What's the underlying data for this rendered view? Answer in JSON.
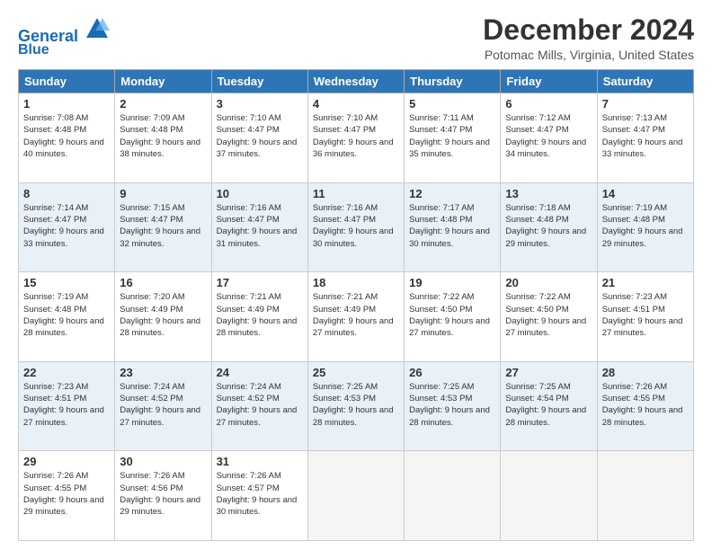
{
  "header": {
    "logo_line1": "General",
    "logo_line2": "Blue",
    "month_title": "December 2024",
    "location": "Potomac Mills, Virginia, United States"
  },
  "days_of_week": [
    "Sunday",
    "Monday",
    "Tuesday",
    "Wednesday",
    "Thursday",
    "Friday",
    "Saturday"
  ],
  "weeks": [
    [
      {
        "day": "1",
        "sunrise": "7:08 AM",
        "sunset": "4:48 PM",
        "daylight": "9 hours and 40 minutes."
      },
      {
        "day": "2",
        "sunrise": "7:09 AM",
        "sunset": "4:48 PM",
        "daylight": "9 hours and 38 minutes."
      },
      {
        "day": "3",
        "sunrise": "7:10 AM",
        "sunset": "4:47 PM",
        "daylight": "9 hours and 37 minutes."
      },
      {
        "day": "4",
        "sunrise": "7:10 AM",
        "sunset": "4:47 PM",
        "daylight": "9 hours and 36 minutes."
      },
      {
        "day": "5",
        "sunrise": "7:11 AM",
        "sunset": "4:47 PM",
        "daylight": "9 hours and 35 minutes."
      },
      {
        "day": "6",
        "sunrise": "7:12 AM",
        "sunset": "4:47 PM",
        "daylight": "9 hours and 34 minutes."
      },
      {
        "day": "7",
        "sunrise": "7:13 AM",
        "sunset": "4:47 PM",
        "daylight": "9 hours and 33 minutes."
      }
    ],
    [
      {
        "day": "8",
        "sunrise": "7:14 AM",
        "sunset": "4:47 PM",
        "daylight": "9 hours and 33 minutes."
      },
      {
        "day": "9",
        "sunrise": "7:15 AM",
        "sunset": "4:47 PM",
        "daylight": "9 hours and 32 minutes."
      },
      {
        "day": "10",
        "sunrise": "7:16 AM",
        "sunset": "4:47 PM",
        "daylight": "9 hours and 31 minutes."
      },
      {
        "day": "11",
        "sunrise": "7:16 AM",
        "sunset": "4:47 PM",
        "daylight": "9 hours and 30 minutes."
      },
      {
        "day": "12",
        "sunrise": "7:17 AM",
        "sunset": "4:48 PM",
        "daylight": "9 hours and 30 minutes."
      },
      {
        "day": "13",
        "sunrise": "7:18 AM",
        "sunset": "4:48 PM",
        "daylight": "9 hours and 29 minutes."
      },
      {
        "day": "14",
        "sunrise": "7:19 AM",
        "sunset": "4:48 PM",
        "daylight": "9 hours and 29 minutes."
      }
    ],
    [
      {
        "day": "15",
        "sunrise": "7:19 AM",
        "sunset": "4:48 PM",
        "daylight": "9 hours and 28 minutes."
      },
      {
        "day": "16",
        "sunrise": "7:20 AM",
        "sunset": "4:49 PM",
        "daylight": "9 hours and 28 minutes."
      },
      {
        "day": "17",
        "sunrise": "7:21 AM",
        "sunset": "4:49 PM",
        "daylight": "9 hours and 28 minutes."
      },
      {
        "day": "18",
        "sunrise": "7:21 AM",
        "sunset": "4:49 PM",
        "daylight": "9 hours and 27 minutes."
      },
      {
        "day": "19",
        "sunrise": "7:22 AM",
        "sunset": "4:50 PM",
        "daylight": "9 hours and 27 minutes."
      },
      {
        "day": "20",
        "sunrise": "7:22 AM",
        "sunset": "4:50 PM",
        "daylight": "9 hours and 27 minutes."
      },
      {
        "day": "21",
        "sunrise": "7:23 AM",
        "sunset": "4:51 PM",
        "daylight": "9 hours and 27 minutes."
      }
    ],
    [
      {
        "day": "22",
        "sunrise": "7:23 AM",
        "sunset": "4:51 PM",
        "daylight": "9 hours and 27 minutes."
      },
      {
        "day": "23",
        "sunrise": "7:24 AM",
        "sunset": "4:52 PM",
        "daylight": "9 hours and 27 minutes."
      },
      {
        "day": "24",
        "sunrise": "7:24 AM",
        "sunset": "4:52 PM",
        "daylight": "9 hours and 27 minutes."
      },
      {
        "day": "25",
        "sunrise": "7:25 AM",
        "sunset": "4:53 PM",
        "daylight": "9 hours and 28 minutes."
      },
      {
        "day": "26",
        "sunrise": "7:25 AM",
        "sunset": "4:53 PM",
        "daylight": "9 hours and 28 minutes."
      },
      {
        "day": "27",
        "sunrise": "7:25 AM",
        "sunset": "4:54 PM",
        "daylight": "9 hours and 28 minutes."
      },
      {
        "day": "28",
        "sunrise": "7:26 AM",
        "sunset": "4:55 PM",
        "daylight": "9 hours and 28 minutes."
      }
    ],
    [
      {
        "day": "29",
        "sunrise": "7:26 AM",
        "sunset": "4:55 PM",
        "daylight": "9 hours and 29 minutes."
      },
      {
        "day": "30",
        "sunrise": "7:26 AM",
        "sunset": "4:56 PM",
        "daylight": "9 hours and 29 minutes."
      },
      {
        "day": "31",
        "sunrise": "7:26 AM",
        "sunset": "4:57 PM",
        "daylight": "9 hours and 30 minutes."
      },
      null,
      null,
      null,
      null
    ]
  ]
}
